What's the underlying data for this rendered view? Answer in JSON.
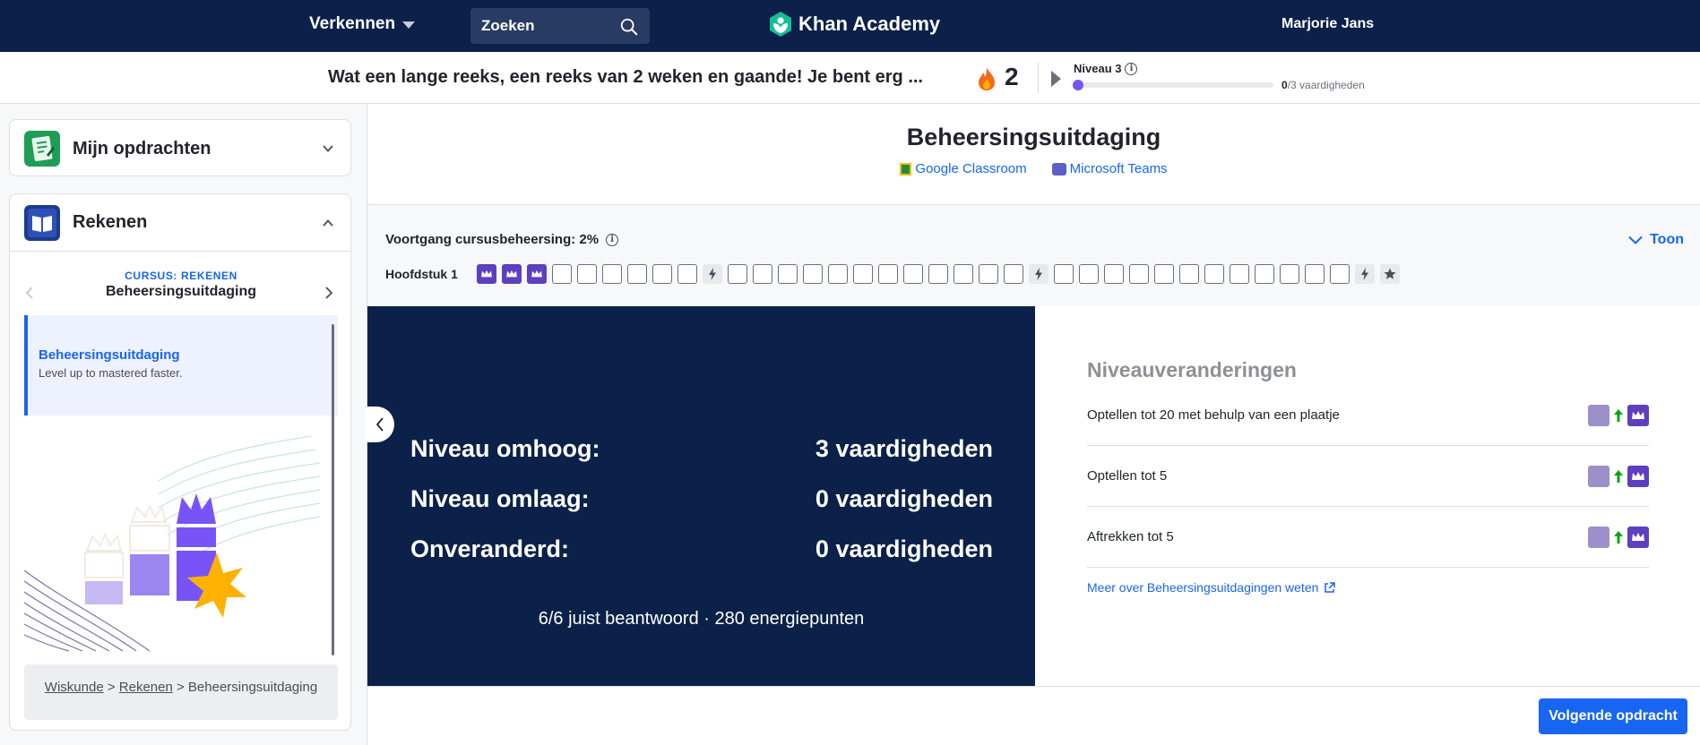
{
  "topnav": {
    "explore_label": "Verkennen",
    "search_placeholder": "Zoeken",
    "logo_text": "Khan Academy",
    "user_name": "Marjorie Jans",
    "bg_color": "#0b2149"
  },
  "streak": {
    "message": "Wat een lange reeks, een reeks van 2 weken en gaande! Je bent erg ...",
    "count": "2",
    "level_label": "Niveau 3",
    "level_progress_value": "0",
    "level_progress_total": "/3 vaardigheden",
    "level_fraction": 0
  },
  "sidebar": {
    "assignments_title": "Mijn opdrachten",
    "course_title": "Rekenen",
    "course_label": "CURSUS: REKENEN",
    "course_unit": "Beheersingsuitdaging",
    "lesson": {
      "title": "Beheersingsuitdaging",
      "subtitle": "Level up to mastered faster."
    },
    "breadcrumb": {
      "item1": "Wiskunde",
      "sep": ">",
      "item2": "Rekenen",
      "item3": "Beheersingsuitdaging"
    }
  },
  "main": {
    "title": "Beheersingsuitdaging",
    "share_google": "Google Classroom",
    "share_teams": "Microsoft Teams",
    "mastery_label": "Voortgang cursusbeheersing: 2%",
    "toon_label": "Toon",
    "chapter_label": "Hoofdstuk 1",
    "skills": [
      "mastered",
      "mastered",
      "mastered",
      "empty",
      "empty",
      "empty",
      "empty",
      "empty",
      "empty",
      "quiz",
      "empty",
      "empty",
      "empty",
      "empty",
      "empty",
      "empty",
      "empty",
      "empty",
      "empty",
      "empty",
      "empty",
      "empty",
      "quiz",
      "empty",
      "empty",
      "empty",
      "empty",
      "empty",
      "empty",
      "empty",
      "empty",
      "empty",
      "empty",
      "empty",
      "empty",
      "quiz",
      "test"
    ]
  },
  "results": {
    "rows": [
      {
        "label": "Niveau omhoog:",
        "value": "3 vaardigheden"
      },
      {
        "label": "Niveau omlaag:",
        "value": "0 vaardigheden"
      },
      {
        "label": "Onveranderd:",
        "value": "0 vaardigheden"
      }
    ],
    "summary": "6/6 juist beantwoord · 280 energiepunten"
  },
  "changes": {
    "title": "Niveauveranderingen",
    "items": [
      {
        "name": "Optellen tot 20 met behulp van een plaatje"
      },
      {
        "name": "Optellen tot 5"
      },
      {
        "name": "Aftrekken tot 5"
      }
    ],
    "more_link": "Meer over Beheersingsuitdagingen weten"
  },
  "footer": {
    "next_label": "Volgende opdracht"
  },
  "colors": {
    "accent": "#1865f2",
    "mastered": "#5e3fbf",
    "familiar": "#9d8fc9",
    "navy": "#0b2149",
    "up_arrow": "#00a60e"
  }
}
